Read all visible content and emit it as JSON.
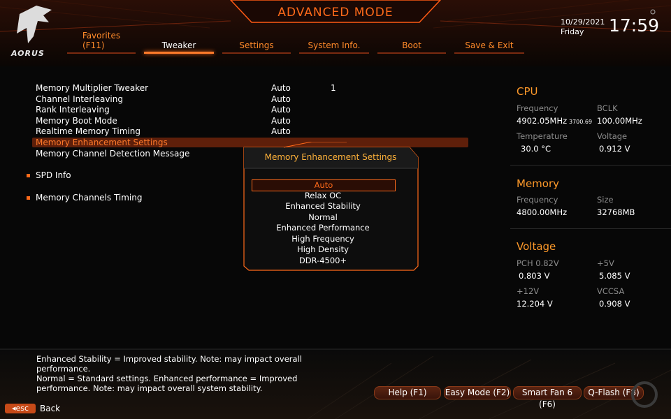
{
  "header": {
    "title": "ADVANCED MODE",
    "brand": "AORUS",
    "date": "10/29/2021",
    "day": "Friday",
    "time": "17:59"
  },
  "tabs": [
    {
      "label": "Favorites",
      "label2": "(F11)",
      "active": false
    },
    {
      "label": "Tweaker",
      "active": true
    },
    {
      "label": "Settings",
      "active": false
    },
    {
      "label": "System Info.",
      "active": false
    },
    {
      "label": "Boot",
      "active": false
    },
    {
      "label": "Save & Exit",
      "active": false
    }
  ],
  "menu": {
    "items": [
      {
        "label": "Memory Multiplier Tweaker",
        "value": "Auto",
        "extra": "1"
      },
      {
        "label": "Channel Interleaving",
        "value": "Auto"
      },
      {
        "label": "Rank Interleaving",
        "value": "Auto"
      },
      {
        "label": "Memory Boot Mode",
        "value": "Auto"
      },
      {
        "label": "Realtime Memory Timing",
        "value": "Auto"
      },
      {
        "label": "Memory Enhancement Settings",
        "value": ""
      },
      {
        "label": "Memory Channel Detection Message",
        "value": ""
      }
    ],
    "submenus": [
      "SPD Info",
      "Memory Channels Timing"
    ],
    "selected_index": 5
  },
  "popup": {
    "title": "Memory Enhancement Settings",
    "options": [
      "Auto",
      "Relax OC",
      "Enhanced Stability",
      "Normal",
      "Enhanced Performance",
      "High Frequency",
      "High Density",
      "DDR-4500+"
    ],
    "selected": "Auto"
  },
  "cpu": {
    "title": "CPU",
    "freq_label": "Frequency",
    "freq_value": "4902.05MHz",
    "freq_small": "3700.69",
    "bclk_label": "BCLK",
    "bclk_value": "100.00MHz",
    "temp_label": "Temperature",
    "temp_value": "30.0 °C",
    "volt_label": "Voltage",
    "volt_value": "0.912 V"
  },
  "memory": {
    "title": "Memory",
    "freq_label": "Frequency",
    "freq_value": "4800.00MHz",
    "size_label": "Size",
    "size_value": "32768MB"
  },
  "voltage": {
    "title": "Voltage",
    "pch_label": "PCH 0.82V",
    "pch_value": "0.803 V",
    "v5_label": "+5V",
    "v5_value": "5.085 V",
    "v12_label": "+12V",
    "v12_value": "12.204 V",
    "vccsa_label": "VCCSA",
    "vccsa_value": "0.908 V"
  },
  "help": {
    "lines": [
      "Enhanced Stability = Improved stability. Note: may impact overall",
      "performance.",
      "Normal = Standard settings. Enhanced performance = Improved",
      "performance. Note: may impact overall system stability."
    ]
  },
  "footer": {
    "buttons": [
      "Help (F1)",
      "Easy Mode (F2)",
      "Smart Fan 6 (F6)",
      "Q-Flash (F8)"
    ],
    "esc": "esc",
    "back": "Back"
  },
  "colors": {
    "accent": "#ff6a1a",
    "header_text": "#ff8a2a",
    "section": "#ff9a2a",
    "selected_row": "#5e1f0a"
  }
}
